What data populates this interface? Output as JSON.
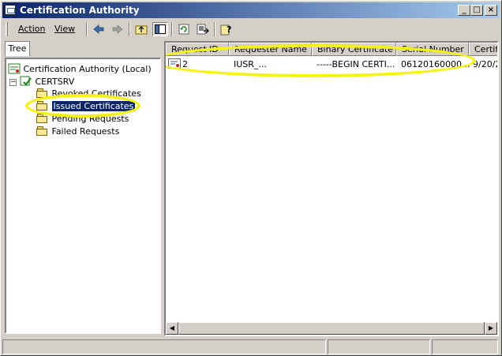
{
  "window": {
    "title": "Certification Authority"
  },
  "title_buttons": {
    "minimize": "_",
    "maximize": "□",
    "close": "×"
  },
  "menu": {
    "action": "Action",
    "view": "View"
  },
  "toolbar": [
    "back-icon",
    "forward-icon",
    "up-folder-icon",
    "show-hide-tree-icon",
    "refresh-icon",
    "export-list-icon",
    "help-icon"
  ],
  "tree_tab": {
    "label": "Tree"
  },
  "tree": {
    "root": "Certification Authority (Local)",
    "server": "CERTSRV",
    "expander": "−",
    "items": [
      {
        "label": "Revoked Certificates"
      },
      {
        "label": "Issued Certificates",
        "selected": true
      },
      {
        "label": "Pending Requests"
      },
      {
        "label": "Failed Requests"
      }
    ]
  },
  "list": {
    "columns": [
      "Request ID",
      "Requester Name",
      "Binary Certificate",
      "Serial Number",
      "Certific"
    ],
    "rows": [
      {
        "request_id": "2",
        "requester": "IUSR_...",
        "binary": "-----BEGIN CERTI...",
        "serial": "06120160000...",
        "cert_date": "9/20/2"
      }
    ]
  },
  "highlight_color": "#f4f412",
  "selection_color": "#0a246a"
}
